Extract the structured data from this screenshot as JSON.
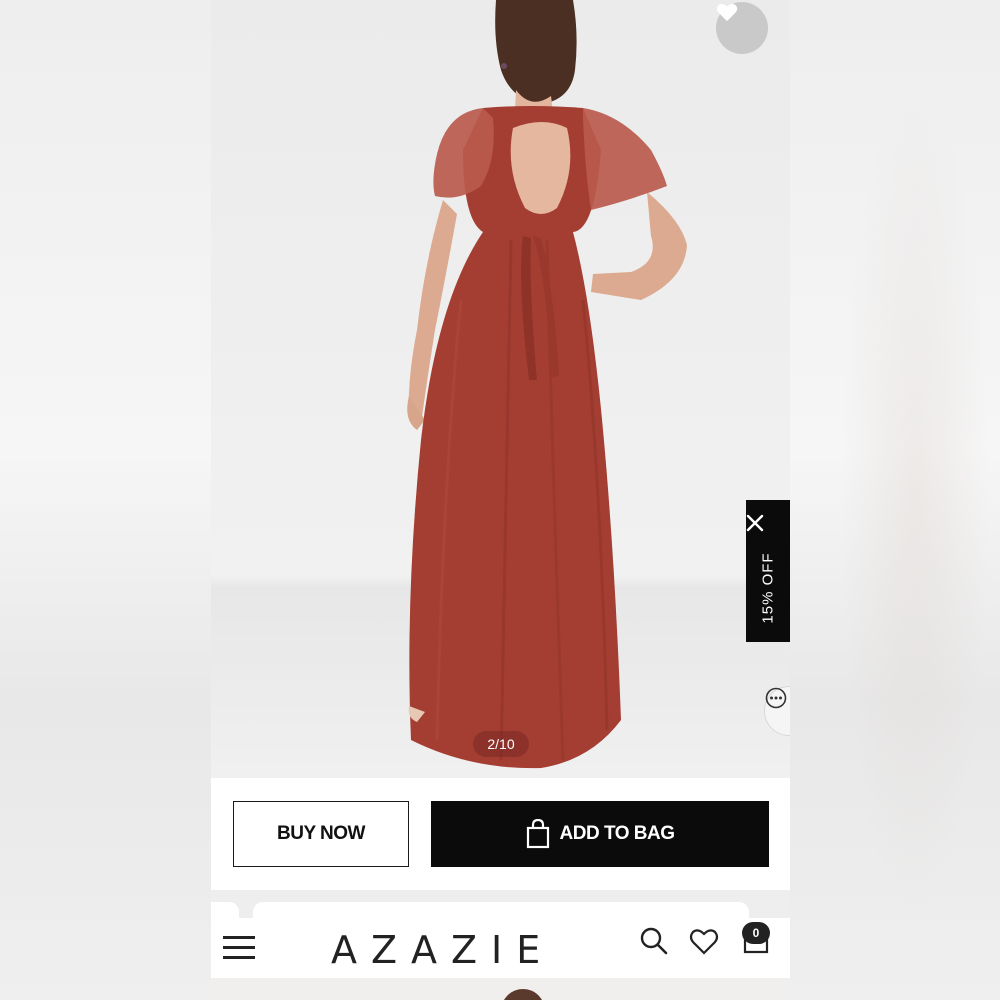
{
  "product": {
    "image_counter": "2/10",
    "favorite_icon": "heart-icon"
  },
  "promo": {
    "text": "15% OFF",
    "close_icon": "close-icon"
  },
  "chat": {
    "icon": "chat-ellipsis-icon"
  },
  "actions": {
    "buy_now": "BUY NOW",
    "add_to_bag": "ADD TO BAG",
    "bag_icon": "shopping-bag-icon"
  },
  "header": {
    "menu_icon": "hamburger-menu-icon",
    "logo": "AZAZIE",
    "search_icon": "search-icon",
    "wishlist_icon": "heart-outline-icon",
    "cart_icon": "bag-icon",
    "cart_count": "0"
  },
  "colors": {
    "dress": "#a43e33",
    "button_dark": "#0b0b0b",
    "promo_bg": "#0b0b0b",
    "background": "#efefef"
  }
}
